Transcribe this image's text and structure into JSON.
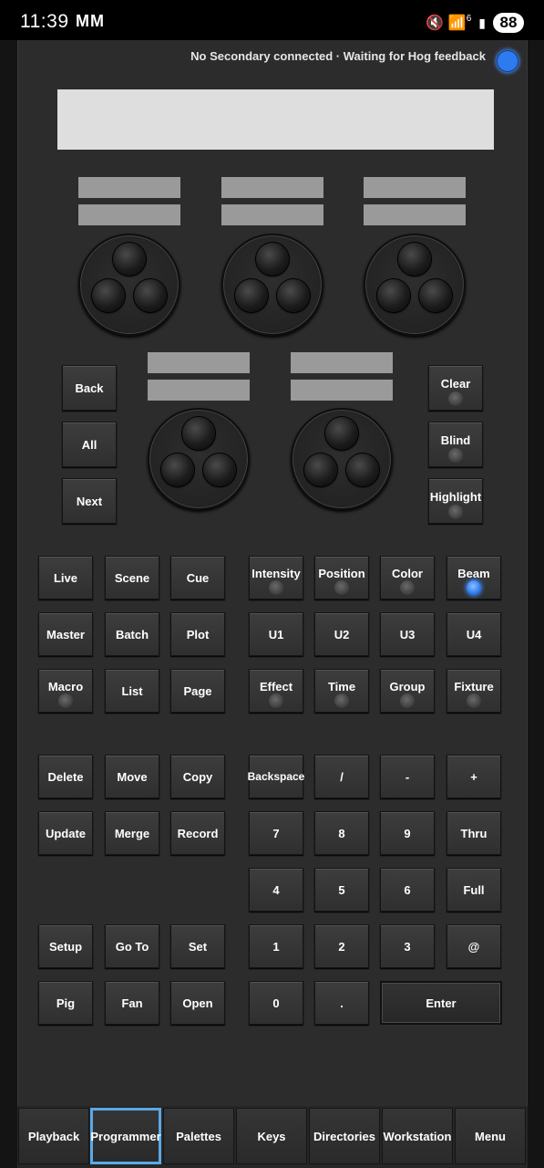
{
  "status_bar": {
    "time": "11:39",
    "left_icons": "MM",
    "right_icons": "🔇 📶",
    "signal_badge": "6",
    "battery": "88"
  },
  "connection": {
    "message": "No Secondary connected · Waiting for Hog feedback",
    "indicator_color": "#2e7bf0"
  },
  "side_buttons_left": [
    "Back",
    "All",
    "Next"
  ],
  "side_buttons_right": [
    "Clear",
    "Blind",
    "Highlight"
  ],
  "left_keypad": {
    "row1": [
      "Live",
      "Scene",
      "Cue"
    ],
    "row2": [
      "Master",
      "Batch",
      "Plot"
    ],
    "row3": [
      "Macro",
      "List",
      "Page"
    ],
    "row4": [
      "Delete",
      "Move",
      "Copy"
    ],
    "row5": [
      "Update",
      "Merge",
      "Record"
    ],
    "row6": [
      "Setup",
      "Go To",
      "Set"
    ],
    "row7": [
      "Pig",
      "Fan",
      "Open"
    ]
  },
  "right_keypad": {
    "row1": [
      "Intensity",
      "Position",
      "Color",
      "Beam"
    ],
    "row2": [
      "U1",
      "U2",
      "U3",
      "U4"
    ],
    "row3": [
      "Effect",
      "Time",
      "Group",
      "Fixture"
    ],
    "row4": [
      "Backspace",
      "/",
      "-",
      "+"
    ],
    "row5": [
      "7",
      "8",
      "9",
      "Thru"
    ],
    "row6": [
      "4",
      "5",
      "6",
      "Full"
    ],
    "row7": [
      "1",
      "2",
      "3",
      "@"
    ],
    "row8": [
      "0",
      ".",
      "Enter"
    ]
  },
  "active_led": "Beam",
  "bottom_tabs": [
    "Playback",
    "Programmer",
    "Palettes",
    "Keys",
    "Directories",
    "Workstation",
    "Menu"
  ],
  "active_tab": "Programmer",
  "colors": {
    "accent": "#2e7bf0",
    "active_tab_border": "#5aa8e8",
    "panel": "#2c2c2c"
  }
}
